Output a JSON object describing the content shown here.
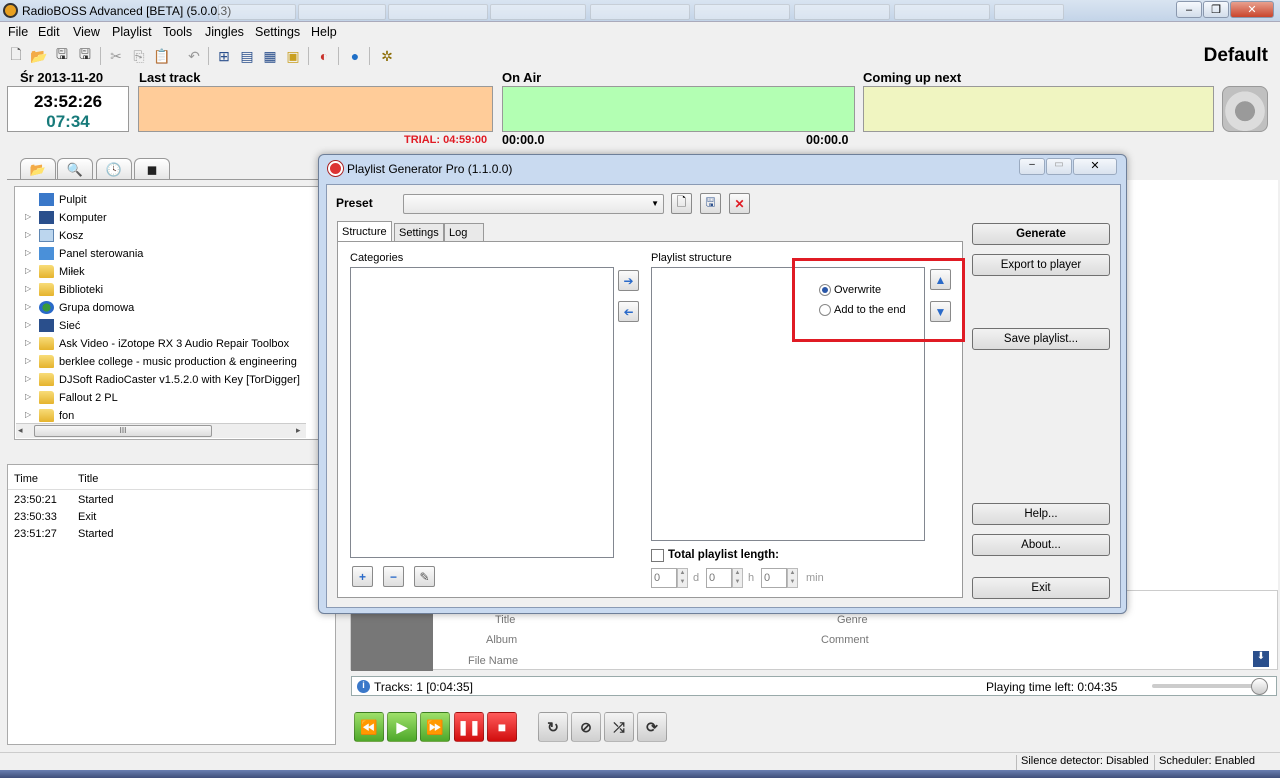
{
  "window": {
    "title": "RadioBOSS Advanced [BETA] (5.0.0.3)",
    "profile": "Default"
  },
  "menu": [
    "File",
    "Edit",
    "View",
    "Playlist",
    "Tools",
    "Jingles",
    "Settings",
    "Help"
  ],
  "toolbar_icons": [
    "new-file-icon",
    "open-folder-icon",
    "save-icon",
    "save-as-icon",
    "cut-icon",
    "copy-icon",
    "paste-icon",
    "undo-icon",
    "add-track-icon",
    "add-folder-icon",
    "add-playlist-icon",
    "add-jingle-icon",
    "mixer-icon",
    "globe-icon",
    "plugin-icon"
  ],
  "header": {
    "date": "Śr 2013-11-20",
    "clock": "23:52:26",
    "countdown": "07:34",
    "last_track": "Last track",
    "on_air": "On Air",
    "coming_up": "Coming up next",
    "trial": "TRIAL: 04:59:00",
    "on_air_elapsed": "00:00.0",
    "on_air_remaining": "00:00.0",
    "colors": {
      "last_track": "#ffcc99",
      "on_air": "#b3ffb3",
      "coming_up": "#f0f5c1"
    }
  },
  "explorer": {
    "tabs": [
      "folder-tab",
      "search-tab",
      "history-tab",
      "cue-tab"
    ],
    "items": [
      {
        "label": "Pulpit",
        "icon": "desktop-icon",
        "expand": false
      },
      {
        "label": "Komputer",
        "icon": "computer-icon",
        "expand": true
      },
      {
        "label": "Kosz",
        "icon": "recycle-bin-icon",
        "expand": true
      },
      {
        "label": "Panel sterowania",
        "icon": "control-panel-icon",
        "expand": true
      },
      {
        "label": "Miłek",
        "icon": "user-folder-icon",
        "expand": true
      },
      {
        "label": "Biblioteki",
        "icon": "libraries-icon",
        "expand": true
      },
      {
        "label": "Grupa domowa",
        "icon": "homegroup-icon",
        "expand": true
      },
      {
        "label": "Sieć",
        "icon": "network-icon",
        "expand": true
      },
      {
        "label": "Ask Video - iZotope RX 3 Audio Repair Toolbox",
        "icon": "folder-icon",
        "expand": true
      },
      {
        "label": "berklee college - music production & engineering",
        "icon": "folder-icon",
        "expand": true
      },
      {
        "label": "DJSoft RadioCaster v1.5.2.0 with Key [TorDigger]",
        "icon": "folder-icon",
        "expand": true
      },
      {
        "label": "Fallout 2 PL",
        "icon": "folder-icon",
        "expand": true
      },
      {
        "label": "fon",
        "icon": "folder-icon",
        "expand": true
      }
    ],
    "scroll_label": "III"
  },
  "log": {
    "col_time": "Time",
    "col_title": "Title",
    "rows": [
      {
        "time": "23:50:21",
        "title": "Started"
      },
      {
        "time": "23:50:33",
        "title": "Exit"
      },
      {
        "time": "23:51:27",
        "title": "Started"
      }
    ]
  },
  "trackinfo": {
    "title": "Title",
    "album": "Album",
    "file": "File Name",
    "genre": "Genre",
    "comment": "Comment"
  },
  "infobar": {
    "tracks": "Tracks: 1 [0:04:35]",
    "time_left": "Playing time left: 0:04:35"
  },
  "status": {
    "silence": "Silence detector: Disabled",
    "scheduler": "Scheduler: Enabled"
  },
  "dialog": {
    "title": "Playlist Generator Pro (1.1.0.0)",
    "preset_label": "Preset",
    "preset_value": "",
    "tabs": [
      "Structure",
      "Settings",
      "Log"
    ],
    "categories_label": "Categories",
    "structure_label": "Playlist structure",
    "overwrite": "Overwrite",
    "add_end": "Add to the end",
    "total_length": "Total playlist length:",
    "days": "0",
    "d": "d",
    "hours": "0",
    "h": "h",
    "minutes": "0",
    "min": "min",
    "buttons": {
      "generate": "Generate",
      "export": "Export to player",
      "save": "Save playlist...",
      "help": "Help...",
      "about": "About...",
      "exit": "Exit"
    }
  }
}
